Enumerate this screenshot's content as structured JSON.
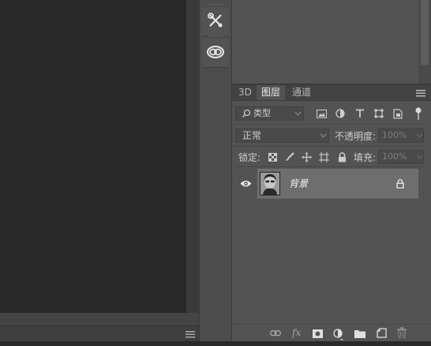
{
  "tabs": [
    {
      "label": "3D"
    },
    {
      "label": "图层"
    },
    {
      "label": "通道"
    }
  ],
  "filter": {
    "placeholder": "类型"
  },
  "blend": {
    "mode": "正常",
    "opacity_label": "不透明度:",
    "opacity_value": "100%"
  },
  "lock": {
    "label": "锁定:",
    "fill_label": "填充:",
    "fill_value": "100%"
  },
  "layers": [
    {
      "name": "背景",
      "visible": true,
      "locked": true
    }
  ],
  "colors": {
    "selected_row": "#6e6e6e",
    "panel": "#535353",
    "canvas": "#282828"
  }
}
